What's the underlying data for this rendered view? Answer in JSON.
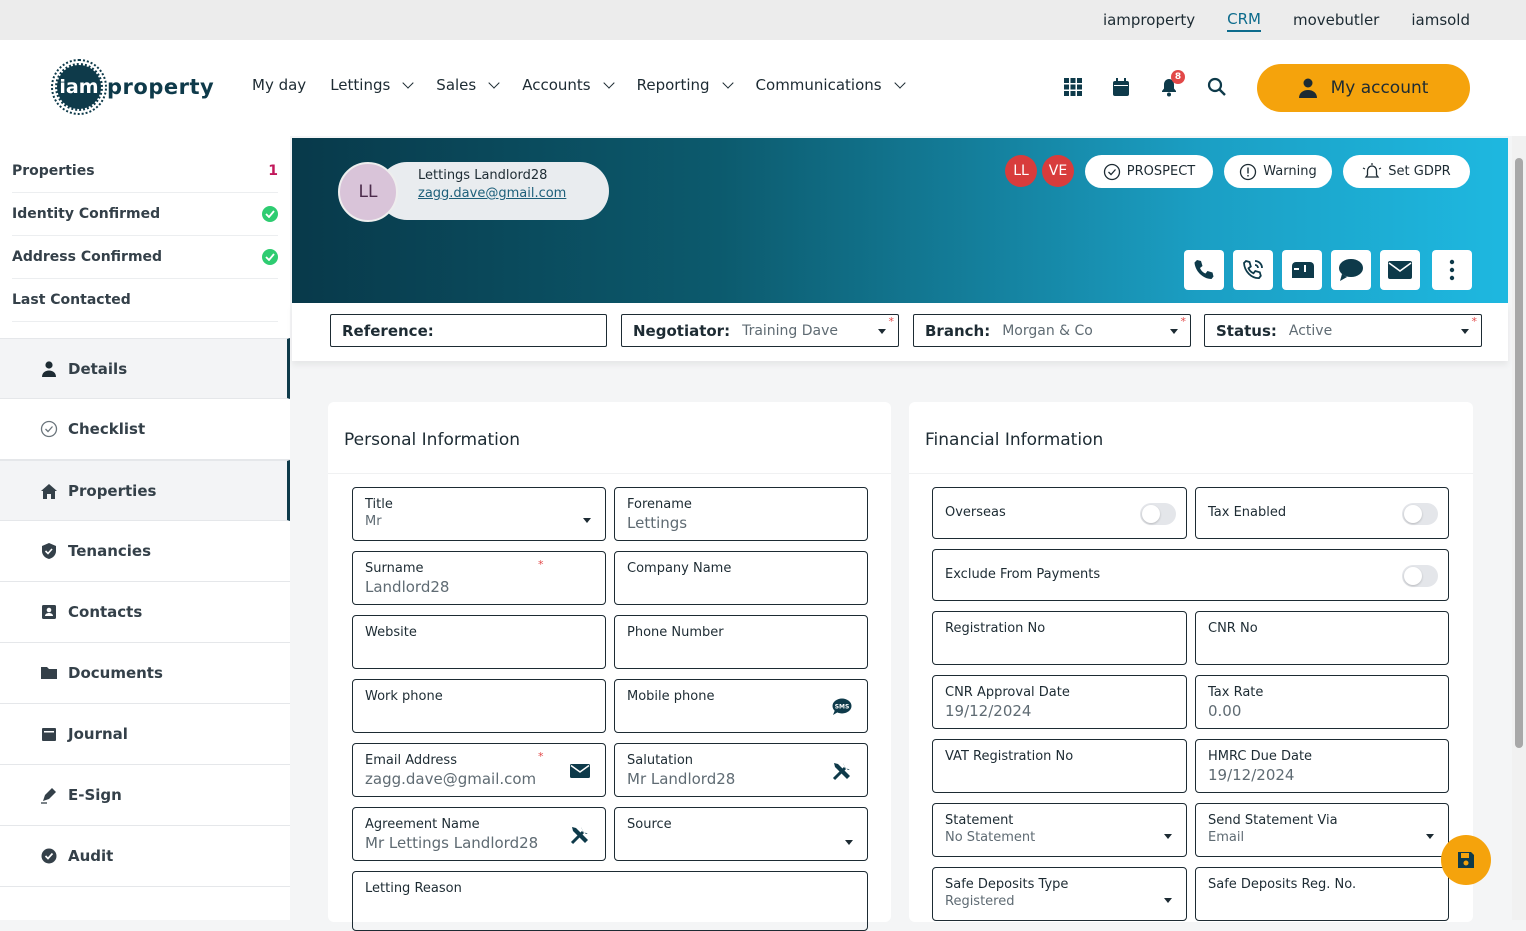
{
  "topbar": {
    "links": [
      "iamproperty",
      "CRM",
      "movebutler",
      "iamsold"
    ]
  },
  "brand": {
    "logo_mark": "iam",
    "logo_text": "property"
  },
  "nav": [
    "My day",
    "Lettings",
    "Sales",
    "Accounts",
    "Reporting",
    "Communications"
  ],
  "header": {
    "notification_count": "8",
    "my_account": "My account"
  },
  "summary": [
    {
      "label": "Properties",
      "value": "1"
    },
    {
      "label": "Identity Confirmed"
    },
    {
      "label": "Address Confirmed"
    },
    {
      "label": "Last Contacted"
    }
  ],
  "menu": [
    "Details",
    "Checklist",
    "Properties",
    "Tenancies",
    "Contacts",
    "Documents",
    "Journal",
    "E-Sign",
    "Audit"
  ],
  "profile": {
    "initials": "LL",
    "name": "Lettings Landlord28",
    "email": "zagg.dave@gmail.com"
  },
  "users": [
    "LL",
    "VE"
  ],
  "chips": {
    "prospect": "PROSPECT",
    "warning": "Warning",
    "gdpr": "Set GDPR"
  },
  "filters": {
    "reference_label": "Reference:",
    "negotiator_label": "Negotiator:",
    "negotiator_value": "Training Dave",
    "branch_label": "Branch:",
    "branch_value": "Morgan & Co",
    "status_label": "Status:",
    "status_value": "Active"
  },
  "personal": {
    "title": "Personal Information",
    "title_label": "Title",
    "title_value": "Mr",
    "forename_label": "Forename",
    "forename_value": "Lettings",
    "surname_label": "Surname",
    "surname_value": "Landlord28",
    "company_label": "Company Name",
    "website_label": "Website",
    "phone_label": "Phone Number",
    "work_label": "Work phone",
    "mobile_label": "Mobile phone",
    "email_label": "Email Address",
    "email_value": "zagg.dave@gmail.com",
    "salutation_label": "Salutation",
    "salutation_value": "Mr Landlord28",
    "agreement_label": "Agreement Name",
    "agreement_value": "Mr Lettings Landlord28",
    "source_label": "Source",
    "letting_label": "Letting Reason"
  },
  "financial": {
    "title": "Financial Information",
    "overseas": "Overseas",
    "tax_enabled": "Tax Enabled",
    "exclude": "Exclude From Payments",
    "reg_no": "Registration No",
    "cnr_no": "CNR No",
    "cnr_date_label": "CNR Approval Date",
    "cnr_date_value": "19/12/2024",
    "tax_rate_label": "Tax Rate",
    "tax_rate_value": "0.00",
    "vat_label": "VAT Registration No",
    "hmrc_label": "HMRC Due Date",
    "hmrc_value": "19/12/2024",
    "statement_label": "Statement",
    "statement_value": "No Statement",
    "send_label": "Send Statement Via",
    "send_value": "Email",
    "sd_type_label": "Safe Deposits Type",
    "sd_type_value": "Registered",
    "sd_reg_label": "Safe Deposits Reg. No."
  }
}
